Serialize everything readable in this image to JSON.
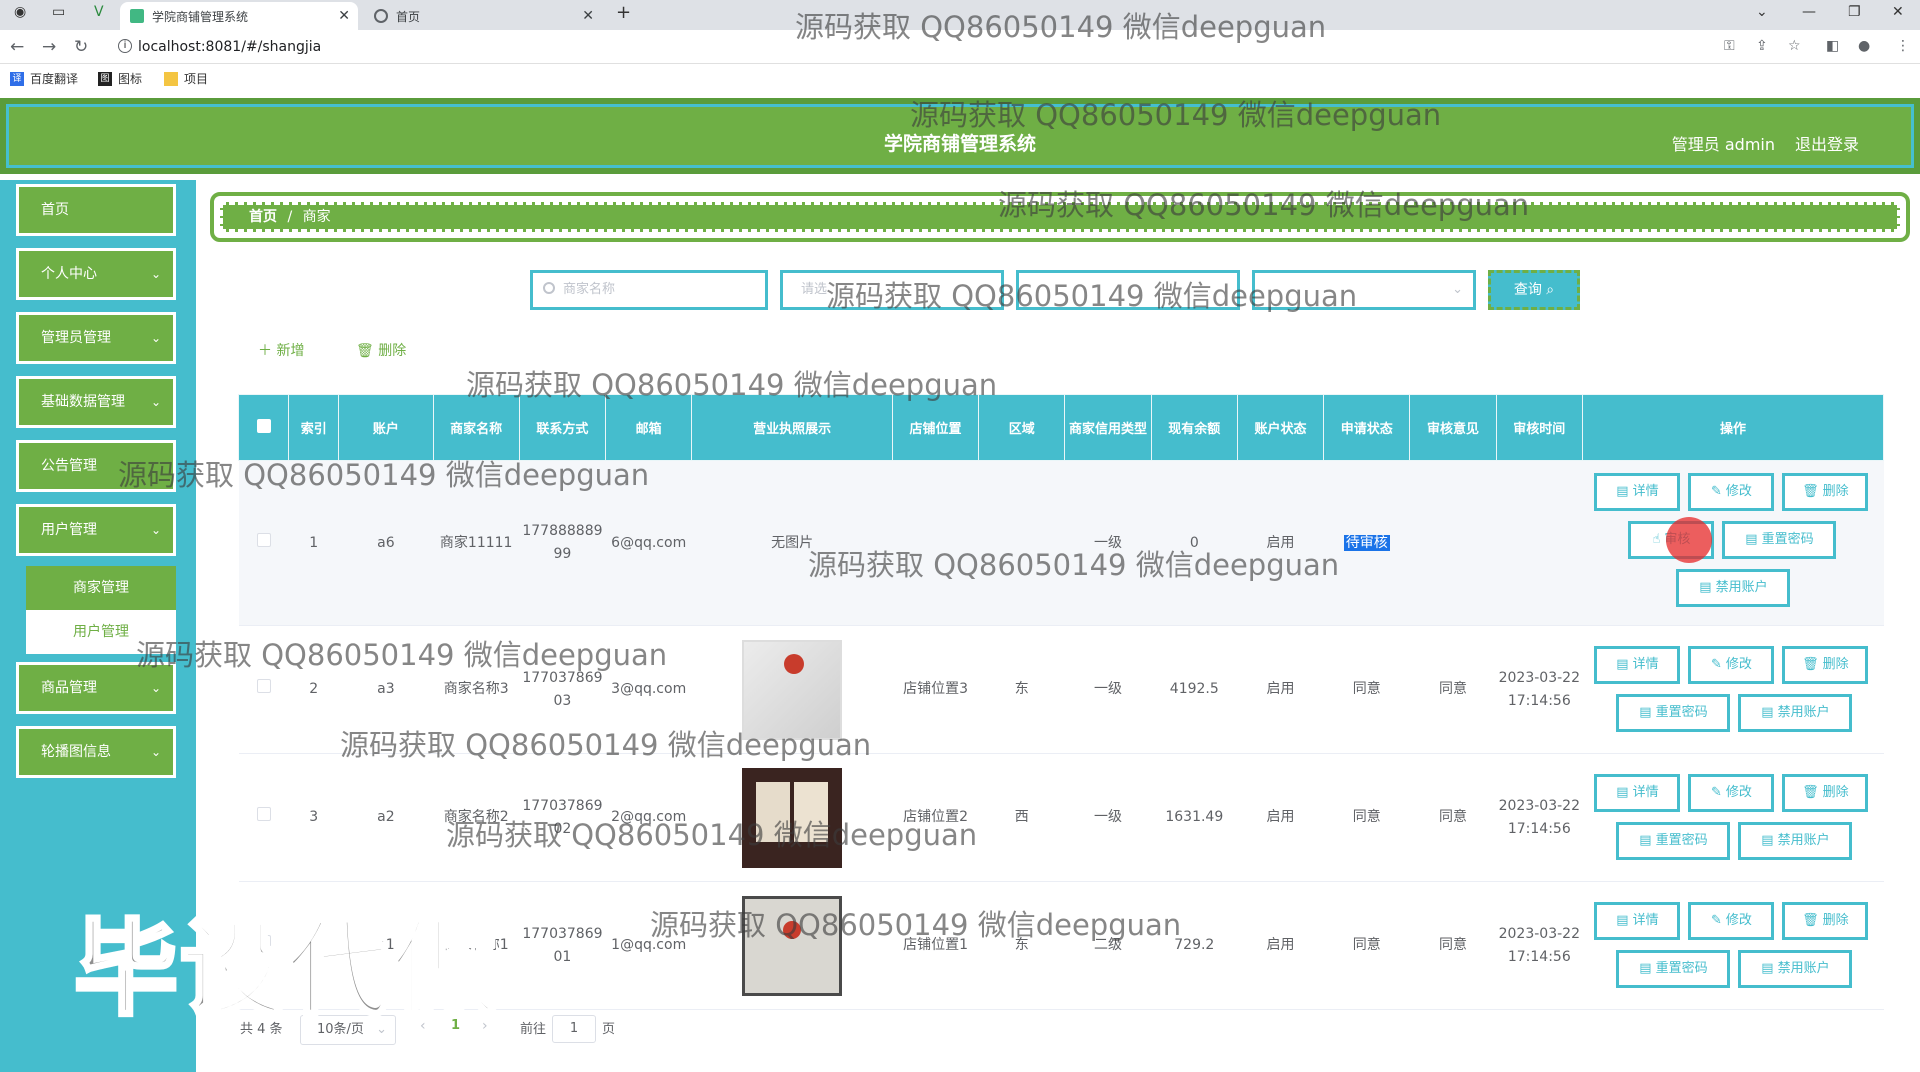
{
  "browser": {
    "tabs": [
      {
        "title": "学院商铺管理系统",
        "active": true
      },
      {
        "title": "首页",
        "active": false
      }
    ],
    "url": "localhost:8081/#/shangjia",
    "bookmarks": [
      "百度翻译",
      "图标",
      "项目"
    ]
  },
  "header": {
    "title": "学院商铺管理系统",
    "user": "管理员 admin",
    "logout": "退出登录"
  },
  "sidebar": {
    "items": [
      {
        "label": "首页",
        "chevron": false
      },
      {
        "label": "个人中心",
        "chevron": true
      },
      {
        "label": "管理员管理",
        "chevron": true
      },
      {
        "label": "基础数据管理",
        "chevron": true
      },
      {
        "label": "公告管理",
        "chevron": false
      },
      {
        "label": "用户管理",
        "chevron": true
      },
      {
        "label": "商品管理",
        "chevron": true
      },
      {
        "label": "轮播图信息",
        "chevron": true
      }
    ],
    "subitems": [
      "商家管理",
      "用户管理"
    ]
  },
  "breadcrumb": {
    "home": "首页",
    "sep": "/",
    "current": "商家"
  },
  "search": {
    "name_placeholder": "商家名称",
    "field2_placeholder": "请选",
    "query_label": "查询"
  },
  "actions": {
    "add": "新增",
    "delete": "删除"
  },
  "table": {
    "headers": [
      "索引",
      "账户",
      "商家名称",
      "联系方式",
      "邮箱",
      "营业执照展示",
      "店铺位置",
      "区域",
      "商家信用类型",
      "现有余额",
      "账户状态",
      "申请状态",
      "审核意见",
      "审核时间",
      "操作"
    ],
    "rows": [
      {
        "index": "1",
        "account": "a6",
        "name": "商家11111",
        "phone": "17788888999",
        "email": "6@qq.com",
        "license": "无图片",
        "location": "",
        "region": "",
        "credit": "一级",
        "balance": "0",
        "status": "启用",
        "apply": "待审核",
        "opinion": "",
        "time": ""
      },
      {
        "index": "2",
        "account": "a3",
        "name": "商家名称3",
        "phone": "17703786903",
        "email": "3@qq.com",
        "license": "",
        "location": "店铺位置3",
        "region": "东",
        "credit": "一级",
        "balance": "4192.5",
        "status": "启用",
        "apply": "同意",
        "opinion": "同意",
        "time": "2023-03-22 17:14:56"
      },
      {
        "index": "3",
        "account": "a2",
        "name": "商家名称2",
        "phone": "17703786902",
        "email": "2@qq.com",
        "license": "",
        "location": "店铺位置2",
        "region": "西",
        "credit": "一级",
        "balance": "1631.49",
        "status": "启用",
        "apply": "同意",
        "opinion": "同意",
        "time": "2023-03-22 17:14:56"
      },
      {
        "index": "4",
        "account": "a1",
        "name": "商家名称1",
        "phone": "17703786901",
        "email": "1@qq.com",
        "license": "",
        "location": "店铺位置1",
        "region": "东",
        "credit": "二级",
        "balance": "729.2",
        "status": "启用",
        "apply": "同意",
        "opinion": "同意",
        "time": "2023-03-22 17:14:56"
      }
    ],
    "ops": {
      "detail": "详情",
      "edit": "修改",
      "delete": "删除",
      "audit": "审核",
      "reset": "重置密码",
      "disable": "禁用账户"
    }
  },
  "pagination": {
    "total": "共 4 条",
    "size": "10条/页",
    "current": "1",
    "goto": "前往",
    "page_input": "1",
    "page_unit": "页"
  },
  "watermark": {
    "text": "源码获取 QQ86050149 微信deepguan",
    "big": "毕设代做"
  },
  "colors": {
    "green": "#6faf45",
    "teal": "#45bdcd"
  }
}
